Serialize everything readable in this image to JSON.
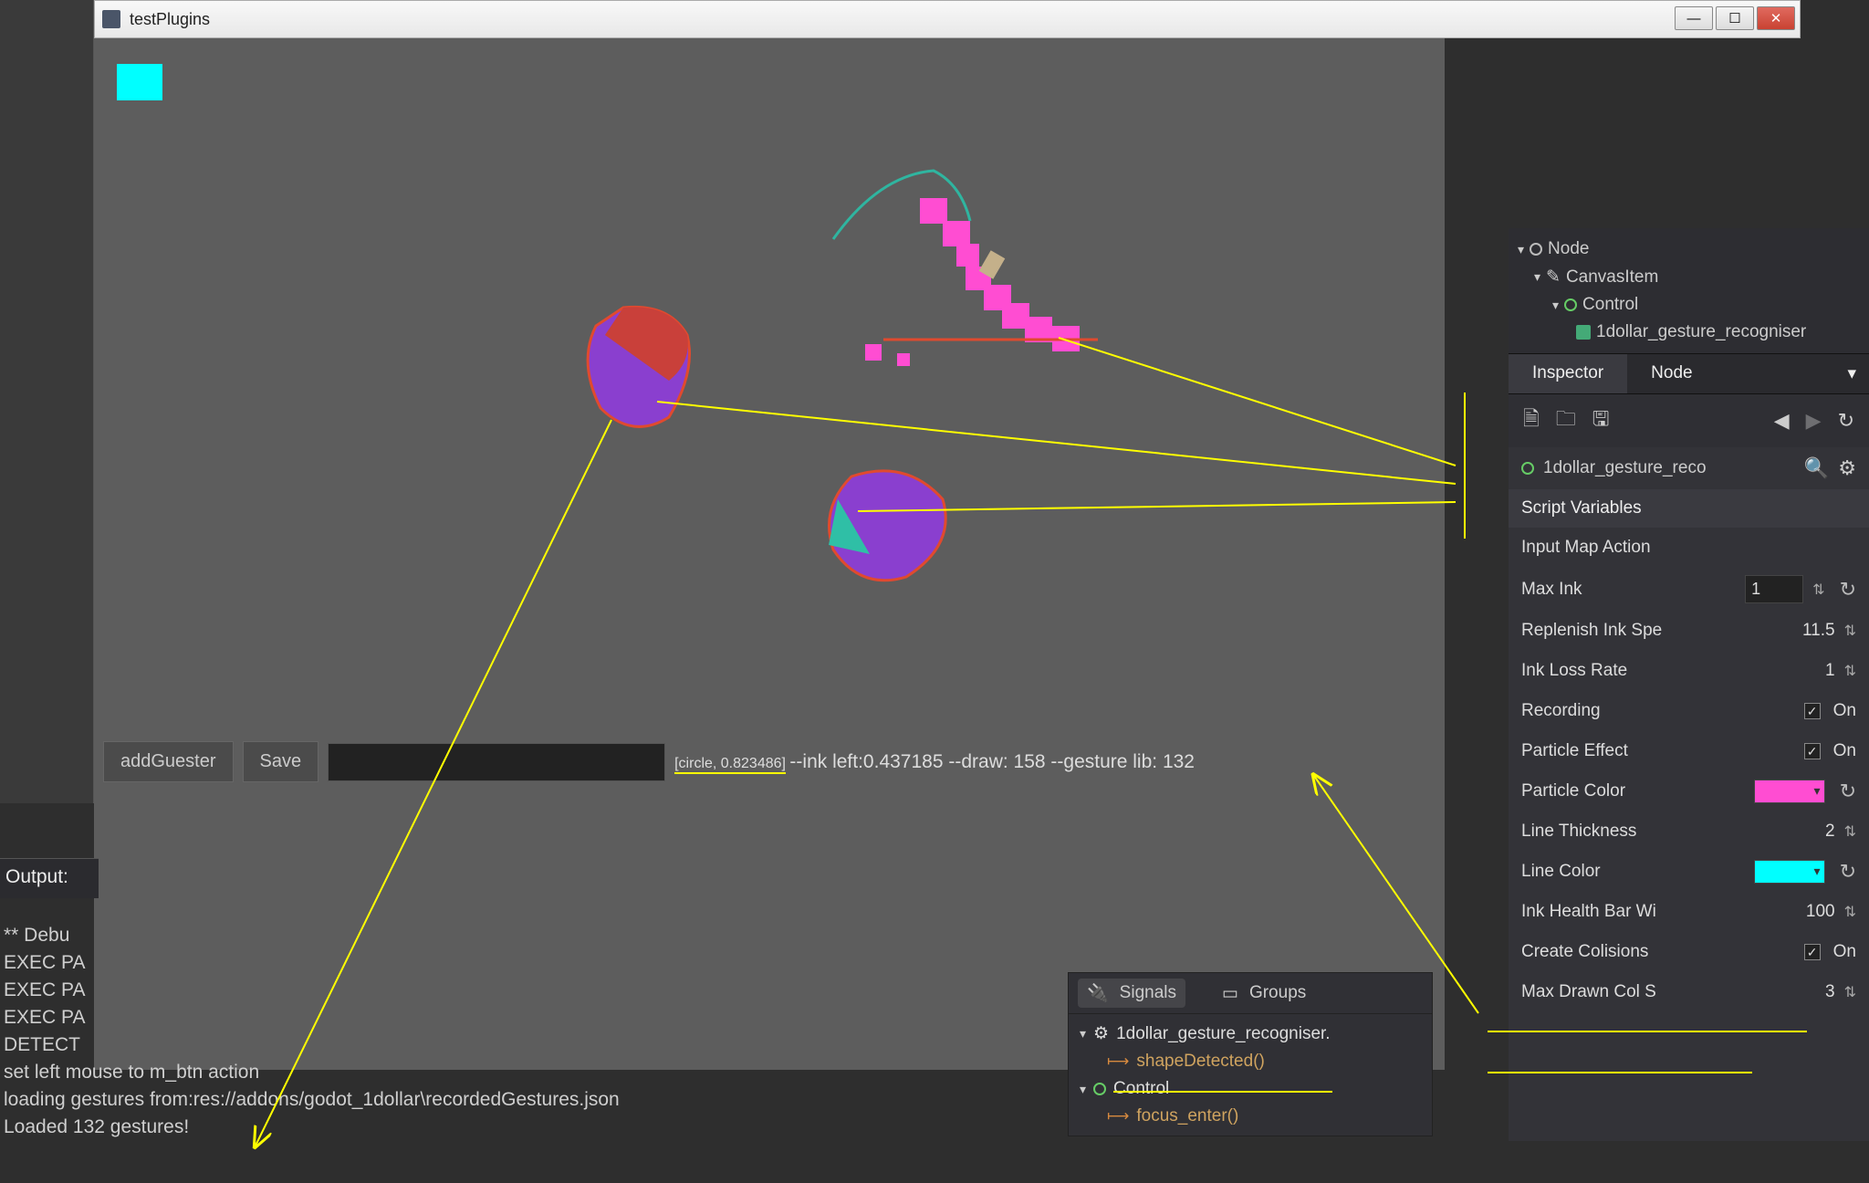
{
  "window": {
    "title": "testPlugins"
  },
  "viewport": {
    "btn_add": "addGuester",
    "btn_save": "Save",
    "status_gesture": "[circle, 0.823486]",
    "status_rest": " --ink left:0.437185 --draw: 158 --gesture lib: 132"
  },
  "tree": {
    "node": "Node",
    "canvas": "CanvasItem",
    "control": "Control",
    "recogniser": "1dollar_gesture_recogniser"
  },
  "tabs": {
    "inspector": "Inspector",
    "node": "Node"
  },
  "inspector": {
    "node_name": "1dollar_gesture_reco",
    "section": "Script Variables",
    "props": {
      "input_map": {
        "label": "Input Map Action"
      },
      "max_ink": {
        "label": "Max Ink",
        "value": "1"
      },
      "replenish": {
        "label": "Replenish Ink Spe",
        "value": "11.5"
      },
      "ink_loss": {
        "label": "Ink Loss Rate",
        "value": "1"
      },
      "recording": {
        "label": "Recording",
        "on": "On"
      },
      "particle_effect": {
        "label": "Particle Effect",
        "on": "On"
      },
      "particle_color": {
        "label": "Particle Color",
        "color": "#ff4dd2"
      },
      "line_thickness": {
        "label": "Line Thickness",
        "value": "2"
      },
      "line_color": {
        "label": "Line Color",
        "color": "#00ffff"
      },
      "ink_bar": {
        "label": "Ink Health Bar Wi",
        "value": "100"
      },
      "create_col": {
        "label": "Create Colisions",
        "on": "On"
      },
      "max_drawn": {
        "label": "Max Drawn Col S",
        "value": "3"
      }
    }
  },
  "signals": {
    "tab_signals": "Signals",
    "tab_groups": "Groups",
    "node_a": "1dollar_gesture_recogniser.",
    "sig_a": "shapeDetected()",
    "node_b": "Control",
    "sig_b": "focus_enter()"
  },
  "output": {
    "header": "Output:",
    "lines": [
      "** Debu",
      "EXEC PA",
      "EXEC PA",
      "EXEC PA",
      "DETECT",
      "set left mouse to m_btn action",
      "loading gestures from:res://addons/godot_1dollar\\recordedGestures.json",
      "Loaded 132 gestures!"
    ]
  }
}
